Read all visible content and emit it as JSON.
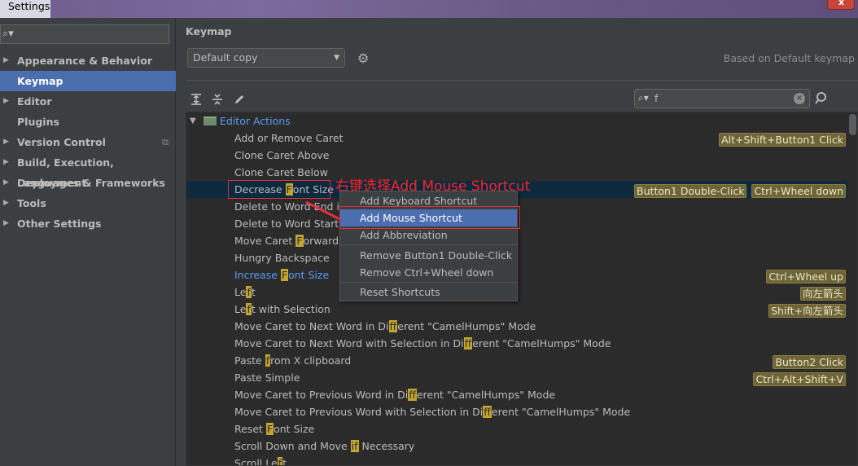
{
  "window": {
    "title": "Settings"
  },
  "sidebar": {
    "search_placeholder": "Q▾",
    "items": [
      {
        "label": "Appearance & Behavior",
        "expandable": true
      },
      {
        "label": "Keymap",
        "expandable": false,
        "selected": true
      },
      {
        "label": "Editor",
        "expandable": true
      },
      {
        "label": "Plugins",
        "expandable": false
      },
      {
        "label": "Version Control",
        "expandable": true
      },
      {
        "label": "Build, Execution, Deployment",
        "expandable": true
      },
      {
        "label": "Languages & Frameworks",
        "expandable": true
      },
      {
        "label": "Tools",
        "expandable": true
      },
      {
        "label": "Other Settings",
        "expandable": true
      }
    ]
  },
  "main": {
    "title": "Keymap",
    "keymap_select": "Default copy",
    "based_on": "Based on Default keymap",
    "filter": {
      "value": "f"
    }
  },
  "tree": {
    "root": "Editor Actions",
    "rows": [
      {
        "text": "Add or Remove Caret",
        "shortcuts": [
          "Alt+Shift+Button1 Click"
        ]
      },
      {
        "text": "Clone Caret Above",
        "shortcuts": []
      },
      {
        "text": "Clone Caret Below",
        "shortcuts": []
      },
      {
        "text": "Decrease ",
        "hl": "F",
        "rest": "ont Size",
        "shortcuts": [
          "Button1 Double-Click",
          "Ctrl+Wheel down"
        ],
        "selected": true
      },
      {
        "text": "Delete to Word End in",
        "shortcuts": []
      },
      {
        "text": "Delete to Word Start in",
        "shortcuts": []
      },
      {
        "text": "Move Caret ",
        "hl": "F",
        "rest": "orward a",
        "shortcuts": []
      },
      {
        "text": "Hungry Backspace",
        "shortcuts": []
      },
      {
        "text": "Increase ",
        "hl": "F",
        "rest": "ont Size",
        "shortcuts": [
          "Ctrl+Wheel up"
        ],
        "link": true
      },
      {
        "text": "Le",
        "hl": "f",
        "rest": "t",
        "shortcuts": [
          "向左箭头"
        ]
      },
      {
        "text": "Le",
        "hl": "f",
        "rest": "t with Selection",
        "shortcuts": [
          "Shift+向左箭头"
        ]
      },
      {
        "text": "Move Caret to Next Word in Di",
        "hl": "ff",
        "rest": "erent \"CamelHumps\" Mode",
        "shortcuts": []
      },
      {
        "text": "Move Caret to Next Word with Selection in Di",
        "hl": "ff",
        "rest": "erent \"CamelHumps\" Mode",
        "shortcuts": []
      },
      {
        "text": "Paste ",
        "hl": "f",
        "rest": "rom X clipboard",
        "shortcuts": [
          "Button2 Click"
        ]
      },
      {
        "text": "Paste Simple",
        "shortcuts": [
          "Ctrl+Alt+Shift+V"
        ]
      },
      {
        "text": "Move Caret to Previous Word in Di",
        "hl": "ff",
        "rest": "erent \"CamelHumps\" Mode",
        "shortcuts": []
      },
      {
        "text": "Move Caret to Previous Word with Selection in Di",
        "hl": "ff",
        "rest": "erent \"CamelHumps\" Mode",
        "shortcuts": []
      },
      {
        "text": "Reset ",
        "hl": "F",
        "rest": "ont Size",
        "shortcuts": []
      },
      {
        "text": "Scroll Down and Move ",
        "hl": "if",
        "rest": " Necessary",
        "shortcuts": []
      },
      {
        "text": "Scroll Le",
        "hl": "f",
        "rest": "t",
        "shortcuts": []
      }
    ]
  },
  "context_menu": {
    "items": [
      {
        "label": "Add Keyboard Shortcut"
      },
      {
        "label": "Add Mouse Shortcut",
        "active": true
      },
      {
        "label": "Add Abbreviation"
      },
      {
        "label": "Remove Button1 Double-Click"
      },
      {
        "label": "Remove Ctrl+Wheel down"
      },
      {
        "label": "Reset Shortcuts"
      }
    ]
  },
  "annotation": {
    "text": "右键选择Add Mouse Shortcut",
    "color": "#ff2424"
  },
  "icons": {
    "expand_all": "expand-all-icon",
    "collapse_all": "collapse-all-icon",
    "edit": "pencil-icon",
    "gear": "gear-icon",
    "find_shortcut": "find-shortcut-icon"
  },
  "colors": {
    "selection": "#4b6eaf",
    "link": "#589df6",
    "shortcut_bg": "#6e6437",
    "highlight": "#c3a42e"
  }
}
